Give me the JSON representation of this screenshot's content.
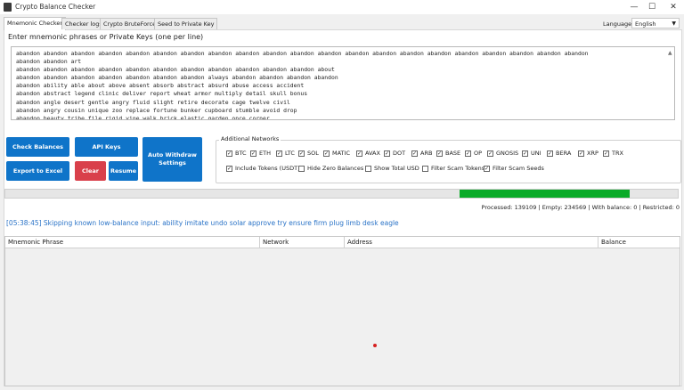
{
  "window": {
    "title": "Crypto Balance Checker",
    "minimize": "—",
    "maximize": "☐",
    "close": "✕"
  },
  "tabs": [
    "Mnemonic Checker",
    "Checker logs",
    "Crypto BruteForce",
    "Seed to Private Key"
  ],
  "language": {
    "label": "Language",
    "value": "English"
  },
  "input": {
    "prompt": "Enter mnemonic phrases or Private Keys (one per line)",
    "lines": [
      "abandon abandon abandon abandon abandon abandon abandon abandon abandon abandon abandon abandon abandon abandon abandon abandon abandon abandon abandon abandon abandon",
      "abandon abandon art",
      "abandon abandon abandon abandon abandon abandon abandon abandon abandon abandon abandon about",
      "abandon abandon abandon abandon abandon abandon abandon always abandon abandon abandon abandon",
      "abandon ability able about above absent absorb abstract absurd abuse access accident",
      "abandon abstract legend clinic deliver report wheat armor multiply detail skull bonus",
      "abandon angle desert gentle angry fluid slight retire decorate cage twelve civil",
      "abandon angry cousin unique zoo replace fortune bunker cupboard stumble avoid drop",
      "abandon beauty tribe file rigid vine walk brick elastic garden once corner"
    ]
  },
  "buttons": {
    "check_balances": "Check Balances",
    "api_keys": "API Keys",
    "auto_withdraw": "Auto Withdraw Settings",
    "export": "Export to Excel",
    "clear": "Clear",
    "resume": "Resume"
  },
  "networks": {
    "title": "Additional Networks",
    "items": [
      "BTC",
      "ETH",
      "LTC",
      "SOL",
      "MATIC",
      "AVAX",
      "DOT",
      "ARB",
      "BASE",
      "OP",
      "GNOSIS",
      "UNI",
      "BERA",
      "XRP",
      "TRX"
    ],
    "options": [
      {
        "label": "Include Tokens (USDT)",
        "checked": true
      },
      {
        "label": "Hide Zero Balances",
        "checked": false
      },
      {
        "label": "Show Total USD",
        "checked": false
      },
      {
        "label": "Filter Scam Tokens",
        "checked": false
      },
      {
        "label": "Filter Scam Seeds",
        "checked": true
      }
    ]
  },
  "progress": {
    "segment_start": 0.675,
    "segment_end": 0.929,
    "color": "#0aab28"
  },
  "stats": "Processed: 139109 | Empty: 234569 | With balance: 0 | Restricted: 0",
  "log": "[05:38:45] Skipping known low-balance input: ability imitate undo solar approve try ensure firm plug limb desk eagle",
  "table": {
    "columns": [
      "Mnemonic Phrase",
      "Network",
      "Address",
      "Balance"
    ]
  },
  "colors": {
    "accent": "#0f74c9",
    "danger": "#d9404b",
    "log": "#2a73c7"
  }
}
